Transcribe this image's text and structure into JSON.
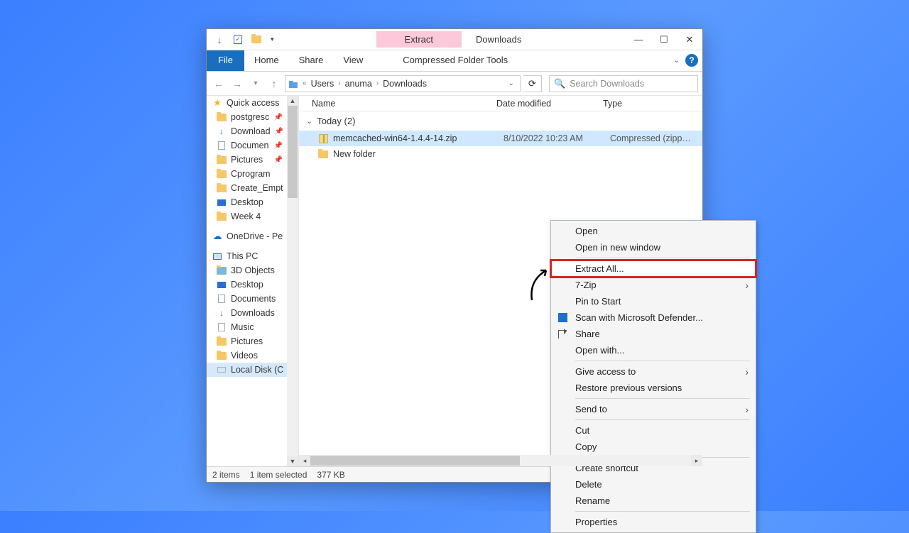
{
  "titlebar": {
    "context_tab": "Extract",
    "title": "Downloads"
  },
  "ribbon": {
    "file": "File",
    "tabs": [
      "Home",
      "Share",
      "View"
    ],
    "context_tools": "Compressed Folder Tools"
  },
  "address": {
    "segments": [
      "Users",
      "anuma",
      "Downloads"
    ]
  },
  "search": {
    "placeholder": "Search Downloads"
  },
  "columns": {
    "name": "Name",
    "date": "Date modified",
    "type": "Type"
  },
  "sidebar": {
    "quick_access": "Quick access",
    "items": [
      {
        "label": "postgresc",
        "icon": "folder",
        "pinned": true
      },
      {
        "label": "Download",
        "icon": "download",
        "pinned": true
      },
      {
        "label": "Documen",
        "icon": "doc",
        "pinned": true
      },
      {
        "label": "Pictures",
        "icon": "folder",
        "pinned": true
      },
      {
        "label": "Cprogram",
        "icon": "folder"
      },
      {
        "label": "Create_Empt",
        "icon": "folder"
      },
      {
        "label": "Desktop",
        "icon": "desktop"
      },
      {
        "label": "Week 4",
        "icon": "folder"
      }
    ],
    "onedrive": "OneDrive - Pe",
    "this_pc": "This PC",
    "pc_items": [
      {
        "label": "3D Objects",
        "icon": "folder3d"
      },
      {
        "label": "Desktop",
        "icon": "desktop"
      },
      {
        "label": "Documents",
        "icon": "doc"
      },
      {
        "label": "Downloads",
        "icon": "download"
      },
      {
        "label": "Music",
        "icon": "note"
      },
      {
        "label": "Pictures",
        "icon": "folder"
      },
      {
        "label": "Videos",
        "icon": "folder"
      },
      {
        "label": "Local Disk (C",
        "icon": "disk",
        "selected": true
      }
    ]
  },
  "group": {
    "label": "Today (2)"
  },
  "files": [
    {
      "name": "memcached-win64-1.4.4-14.zip",
      "date": "8/10/2022 10:23 AM",
      "type": "Compressed (zipp…",
      "icon": "zip",
      "selected": true
    },
    {
      "name": "New folder",
      "date": "",
      "type": "",
      "icon": "folder"
    }
  ],
  "context_menu": {
    "items": [
      {
        "label": "Open"
      },
      {
        "label": "Open in new window"
      },
      {
        "sep": true
      },
      {
        "label": "Extract All...",
        "highlight": true
      },
      {
        "label": "7-Zip",
        "submenu": true
      },
      {
        "label": "Pin to Start"
      },
      {
        "label": "Scan with Microsoft Defender...",
        "icon": "shield"
      },
      {
        "label": "Share",
        "icon": "share"
      },
      {
        "label": "Open with..."
      },
      {
        "sep": true
      },
      {
        "label": "Give access to",
        "submenu": true
      },
      {
        "label": "Restore previous versions"
      },
      {
        "sep": true
      },
      {
        "label": "Send to",
        "submenu": true
      },
      {
        "sep": true
      },
      {
        "label": "Cut"
      },
      {
        "label": "Copy"
      },
      {
        "sep": true
      },
      {
        "label": "Create shortcut"
      },
      {
        "label": "Delete"
      },
      {
        "label": "Rename"
      },
      {
        "sep": true
      },
      {
        "label": "Properties"
      }
    ]
  },
  "status": {
    "count": "2 items",
    "selection": "1 item selected",
    "size": "377 KB"
  }
}
